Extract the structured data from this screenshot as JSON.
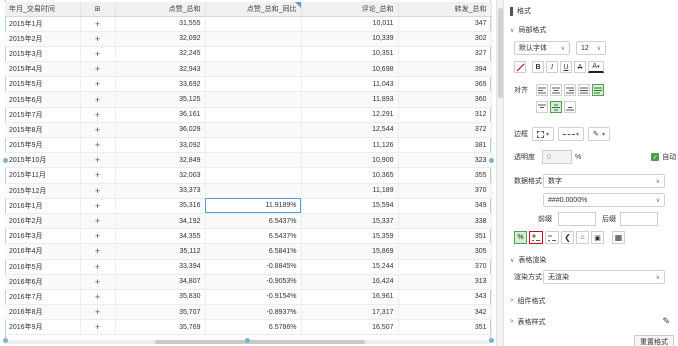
{
  "table": {
    "headers": {
      "date": "年月_交易时间",
      "add": "⊞",
      "likes": "点赞_总和",
      "likes_ratio": "点赞_总和_同比",
      "comments": "评论_总和",
      "shares": "转发_总和"
    },
    "plus": "+",
    "rows": [
      {
        "date": "2015年1月",
        "likes": "31,555",
        "ratio": "",
        "comments": "10,011",
        "shares": "347"
      },
      {
        "date": "2015年2月",
        "likes": "32,092",
        "ratio": "",
        "comments": "10,339",
        "shares": "302"
      },
      {
        "date": "2015年3月",
        "likes": "32,245",
        "ratio": "",
        "comments": "10,351",
        "shares": "327"
      },
      {
        "date": "2015年4月",
        "likes": "32,943",
        "ratio": "",
        "comments": "10,698",
        "shares": "394"
      },
      {
        "date": "2015年5月",
        "likes": "33,692",
        "ratio": "",
        "comments": "11,043",
        "shares": "365"
      },
      {
        "date": "2015年6月",
        "likes": "35,125",
        "ratio": "",
        "comments": "11,893",
        "shares": "360"
      },
      {
        "date": "2015年7月",
        "likes": "36,161",
        "ratio": "",
        "comments": "12,291",
        "shares": "312"
      },
      {
        "date": "2015年8月",
        "likes": "36,029",
        "ratio": "",
        "comments": "12,544",
        "shares": "372"
      },
      {
        "date": "2015年9月",
        "likes": "33,092",
        "ratio": "",
        "comments": "11,126",
        "shares": "381"
      },
      {
        "date": "2015年10月",
        "likes": "32,849",
        "ratio": "",
        "comments": "10,900",
        "shares": "323"
      },
      {
        "date": "2015年11月",
        "likes": "32,003",
        "ratio": "",
        "comments": "10,365",
        "shares": "355"
      },
      {
        "date": "2015年12月",
        "likes": "33,373",
        "ratio": "",
        "comments": "11,189",
        "shares": "370"
      },
      {
        "date": "2016年1月",
        "likes": "35,316",
        "ratio": "11.9189%",
        "comments": "15,594",
        "shares": "349"
      },
      {
        "date": "2016年2月",
        "likes": "34,192",
        "ratio": "6.5437%",
        "comments": "15,337",
        "shares": "338"
      },
      {
        "date": "2016年3月",
        "likes": "34,355",
        "ratio": "6.5437%",
        "comments": "15,359",
        "shares": "351"
      },
      {
        "date": "2016年4月",
        "likes": "35,112",
        "ratio": "6.5841%",
        "comments": "15,869",
        "shares": "305"
      },
      {
        "date": "2016年5月",
        "likes": "33,394",
        "ratio": "-0.8845%",
        "comments": "15,244",
        "shares": "370"
      },
      {
        "date": "2016年6月",
        "likes": "34,807",
        "ratio": "-0.9053%",
        "comments": "16,424",
        "shares": "313"
      },
      {
        "date": "2016年7月",
        "likes": "35,830",
        "ratio": "-0.9154%",
        "comments": "16,961",
        "shares": "343"
      },
      {
        "date": "2016年8月",
        "likes": "35,707",
        "ratio": "-0.8937%",
        "comments": "17,317",
        "shares": "342"
      },
      {
        "date": "2016年9月",
        "likes": "35,769",
        "ratio": "6.5786%",
        "comments": "16,507",
        "shares": "351"
      }
    ]
  },
  "panel": {
    "title": "格式",
    "local_format": "局部格式",
    "font_family": "默认字体",
    "font_size": "12",
    "bold": "B",
    "italic": "I",
    "underline": "U",
    "strike": "A",
    "font_color": "A",
    "align_label": "对齐",
    "border_label": "边框",
    "opacity_label": "透明度",
    "opacity_value": "0",
    "percent_sign": "%",
    "auto_label": "自动",
    "data_format_label": "数据格式",
    "data_format_value": "数字",
    "number_pattern": "###0.0000%",
    "prefix_label": "前缀",
    "suffix_label": "后缀",
    "pct_btn": "%",
    "table_render": "表格渲染",
    "render_mode_label": "渲染方式",
    "render_mode_value": "无渲染",
    "component_format": "组件格式",
    "table_style": "表格样式",
    "reset_button": "重置格式"
  }
}
